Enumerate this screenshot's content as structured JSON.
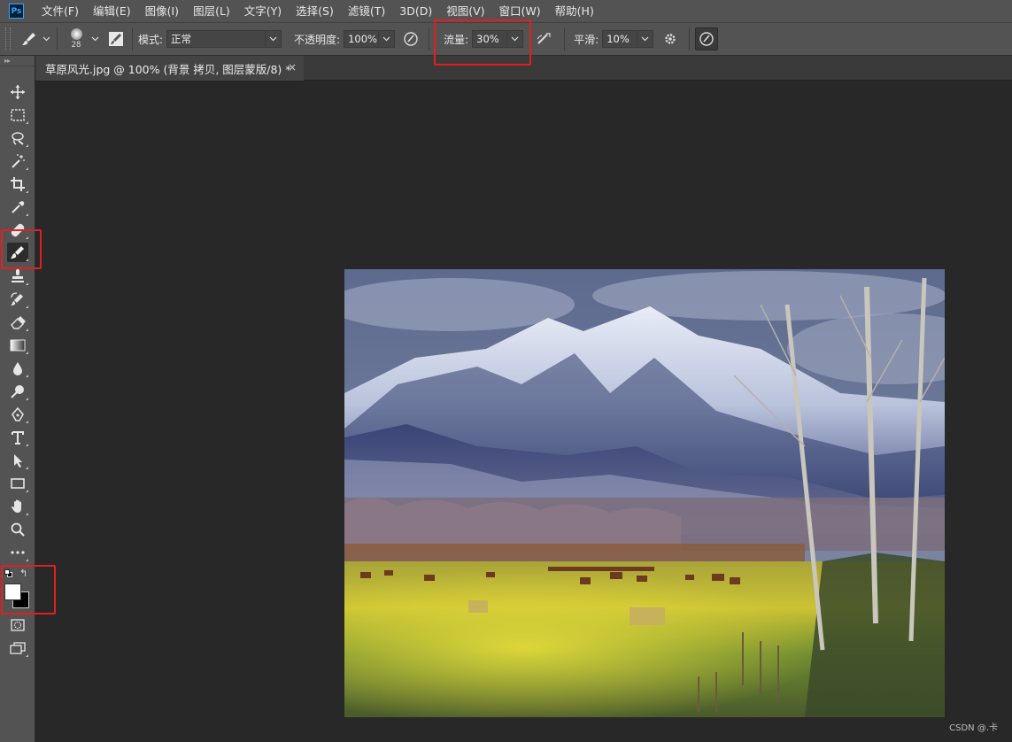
{
  "app": {
    "logo_text": "Ps"
  },
  "menus": [
    "文件(F)",
    "编辑(E)",
    "图像(I)",
    "图层(L)",
    "文字(Y)",
    "选择(S)",
    "滤镜(T)",
    "3D(D)",
    "视图(V)",
    "窗口(W)",
    "帮助(H)"
  ],
  "options": {
    "brush_size": "28",
    "mode_label": "模式:",
    "mode_value": "正常",
    "opacity_label": "不透明度:",
    "opacity_value": "100%",
    "flow_label": "流量:",
    "flow_value": "30%",
    "smoothing_label": "平滑:",
    "smoothing_value": "10%"
  },
  "document": {
    "tab_title": "草原风光.jpg @ 100% (背景 拷贝, 图层蒙版/8) *",
    "close_glyph": "×"
  },
  "tools": [
    "move-tool",
    "marquee-tool",
    "lasso-tool",
    "magic-wand-tool",
    "crop-tool",
    "eyedropper-tool",
    "healing-brush-tool",
    "brush-tool",
    "clone-stamp-tool",
    "history-brush-tool",
    "eraser-tool",
    "gradient-tool",
    "blur-tool",
    "dodge-tool",
    "pen-tool",
    "type-tool",
    "path-selection-tool",
    "rectangle-tool",
    "hand-tool",
    "zoom-tool",
    "more-tools"
  ],
  "colors": {
    "foreground": "#ffffff",
    "background": "#000000",
    "highlight": "#e02020"
  },
  "watermark": "CSDN @.卡"
}
